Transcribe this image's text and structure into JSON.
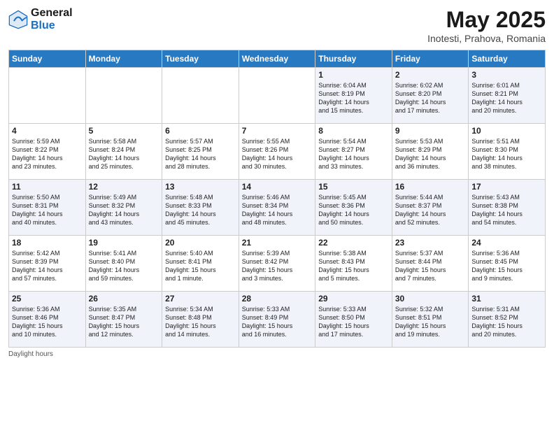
{
  "header": {
    "logo_line1": "General",
    "logo_line2": "Blue",
    "month": "May 2025",
    "location": "Inotesti, Prahova, Romania"
  },
  "weekdays": [
    "Sunday",
    "Monday",
    "Tuesday",
    "Wednesday",
    "Thursday",
    "Friday",
    "Saturday"
  ],
  "weeks": [
    [
      {
        "day": "",
        "info": ""
      },
      {
        "day": "",
        "info": ""
      },
      {
        "day": "",
        "info": ""
      },
      {
        "day": "",
        "info": ""
      },
      {
        "day": "1",
        "info": "Sunrise: 6:04 AM\nSunset: 8:19 PM\nDaylight: 14 hours\nand 15 minutes."
      },
      {
        "day": "2",
        "info": "Sunrise: 6:02 AM\nSunset: 8:20 PM\nDaylight: 14 hours\nand 17 minutes."
      },
      {
        "day": "3",
        "info": "Sunrise: 6:01 AM\nSunset: 8:21 PM\nDaylight: 14 hours\nand 20 minutes."
      }
    ],
    [
      {
        "day": "4",
        "info": "Sunrise: 5:59 AM\nSunset: 8:22 PM\nDaylight: 14 hours\nand 23 minutes."
      },
      {
        "day": "5",
        "info": "Sunrise: 5:58 AM\nSunset: 8:24 PM\nDaylight: 14 hours\nand 25 minutes."
      },
      {
        "day": "6",
        "info": "Sunrise: 5:57 AM\nSunset: 8:25 PM\nDaylight: 14 hours\nand 28 minutes."
      },
      {
        "day": "7",
        "info": "Sunrise: 5:55 AM\nSunset: 8:26 PM\nDaylight: 14 hours\nand 30 minutes."
      },
      {
        "day": "8",
        "info": "Sunrise: 5:54 AM\nSunset: 8:27 PM\nDaylight: 14 hours\nand 33 minutes."
      },
      {
        "day": "9",
        "info": "Sunrise: 5:53 AM\nSunset: 8:29 PM\nDaylight: 14 hours\nand 36 minutes."
      },
      {
        "day": "10",
        "info": "Sunrise: 5:51 AM\nSunset: 8:30 PM\nDaylight: 14 hours\nand 38 minutes."
      }
    ],
    [
      {
        "day": "11",
        "info": "Sunrise: 5:50 AM\nSunset: 8:31 PM\nDaylight: 14 hours\nand 40 minutes."
      },
      {
        "day": "12",
        "info": "Sunrise: 5:49 AM\nSunset: 8:32 PM\nDaylight: 14 hours\nand 43 minutes."
      },
      {
        "day": "13",
        "info": "Sunrise: 5:48 AM\nSunset: 8:33 PM\nDaylight: 14 hours\nand 45 minutes."
      },
      {
        "day": "14",
        "info": "Sunrise: 5:46 AM\nSunset: 8:34 PM\nDaylight: 14 hours\nand 48 minutes."
      },
      {
        "day": "15",
        "info": "Sunrise: 5:45 AM\nSunset: 8:36 PM\nDaylight: 14 hours\nand 50 minutes."
      },
      {
        "day": "16",
        "info": "Sunrise: 5:44 AM\nSunset: 8:37 PM\nDaylight: 14 hours\nand 52 minutes."
      },
      {
        "day": "17",
        "info": "Sunrise: 5:43 AM\nSunset: 8:38 PM\nDaylight: 14 hours\nand 54 minutes."
      }
    ],
    [
      {
        "day": "18",
        "info": "Sunrise: 5:42 AM\nSunset: 8:39 PM\nDaylight: 14 hours\nand 57 minutes."
      },
      {
        "day": "19",
        "info": "Sunrise: 5:41 AM\nSunset: 8:40 PM\nDaylight: 14 hours\nand 59 minutes."
      },
      {
        "day": "20",
        "info": "Sunrise: 5:40 AM\nSunset: 8:41 PM\nDaylight: 15 hours\nand 1 minute."
      },
      {
        "day": "21",
        "info": "Sunrise: 5:39 AM\nSunset: 8:42 PM\nDaylight: 15 hours\nand 3 minutes."
      },
      {
        "day": "22",
        "info": "Sunrise: 5:38 AM\nSunset: 8:43 PM\nDaylight: 15 hours\nand 5 minutes."
      },
      {
        "day": "23",
        "info": "Sunrise: 5:37 AM\nSunset: 8:44 PM\nDaylight: 15 hours\nand 7 minutes."
      },
      {
        "day": "24",
        "info": "Sunrise: 5:36 AM\nSunset: 8:45 PM\nDaylight: 15 hours\nand 9 minutes."
      }
    ],
    [
      {
        "day": "25",
        "info": "Sunrise: 5:36 AM\nSunset: 8:46 PM\nDaylight: 15 hours\nand 10 minutes."
      },
      {
        "day": "26",
        "info": "Sunrise: 5:35 AM\nSunset: 8:47 PM\nDaylight: 15 hours\nand 12 minutes."
      },
      {
        "day": "27",
        "info": "Sunrise: 5:34 AM\nSunset: 8:48 PM\nDaylight: 15 hours\nand 14 minutes."
      },
      {
        "day": "28",
        "info": "Sunrise: 5:33 AM\nSunset: 8:49 PM\nDaylight: 15 hours\nand 16 minutes."
      },
      {
        "day": "29",
        "info": "Sunrise: 5:33 AM\nSunset: 8:50 PM\nDaylight: 15 hours\nand 17 minutes."
      },
      {
        "day": "30",
        "info": "Sunrise: 5:32 AM\nSunset: 8:51 PM\nDaylight: 15 hours\nand 19 minutes."
      },
      {
        "day": "31",
        "info": "Sunrise: 5:31 AM\nSunset: 8:52 PM\nDaylight: 15 hours\nand 20 minutes."
      }
    ]
  ],
  "footer": "Daylight hours"
}
